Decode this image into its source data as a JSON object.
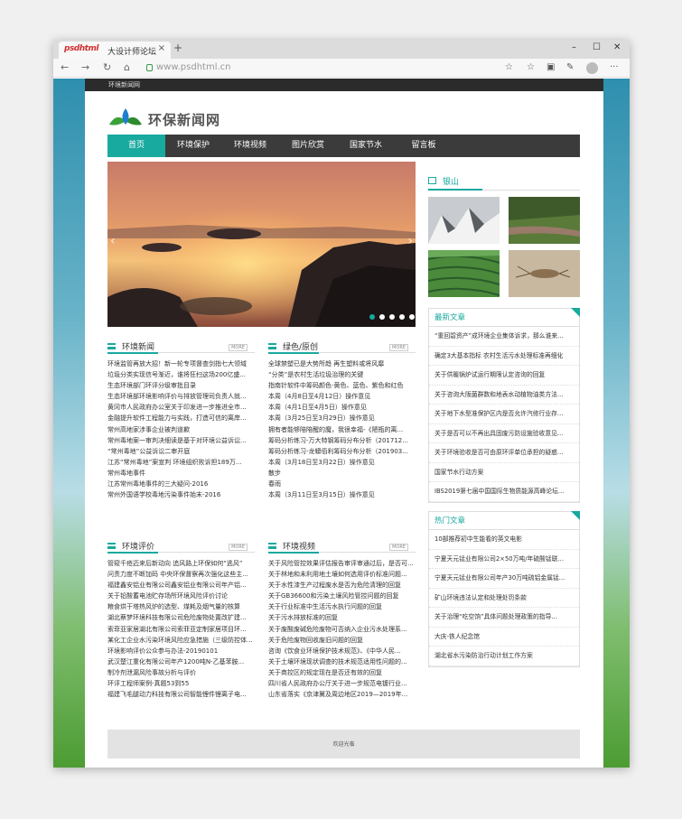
{
  "browser": {
    "tab_logo": "psdhtml",
    "tab_title": "大设计师论坛",
    "tab_close": "×",
    "new_tab": "+",
    "url": "www.psdhtml.cn",
    "win_min": "–",
    "win_max": "☐",
    "win_close": "✕",
    "back": "←",
    "forward": "→",
    "reload": "↻",
    "home": "⌂",
    "star": "☆",
    "more": "···"
  },
  "site": {
    "top_strip": "环境新闻网",
    "logo_text": "环保新闻网",
    "brand_color": "#18a99f",
    "nav": [
      "首页",
      "环境保护",
      "环境视频",
      "图片欣赏",
      "国家节水",
      "留言板"
    ],
    "active_nav": 0
  },
  "sections": {
    "news": {
      "title": "环境新闻",
      "more": "MORE",
      "items": [
        "环境监管再放大招！新一轮专项督查剑指七大领域",
        "垃圾分类实现信号渐近，谁将狂扫这场200亿盛...",
        "生态环境部门环评分级审批目录",
        "生态环境部环境影响评价与排放管理司负责人就...",
        "黄冈市人民政府办公室关于印发进一步推进全市...",
        "金融提升软件工程能力与实践，打造可信的离岸...",
        "常州高地家涉事企业被判道歉",
        "常州毒地案一审判决细读是基于对环境公益诉讼...",
        "“常州毒地”公益诉讼二审开庭",
        "江苏“常州毒地”案宣判 环境组织败诉担189万...",
        "常州毒地事件",
        "江苏常州毒地事件的三大疑问-2016",
        "常州外国语学校毒地污染事件始末-2016"
      ]
    },
    "green": {
      "title": "绿色/原创",
      "more": "MORE",
      "items": [
        "全球禁塑已是大势所趋 再生塑料或将风靡",
        "“分类”是农村生活垃圾治理的关键",
        "指南针软件中筹码颜色-黄色、蓝色、紫色和红色",
        "本周（4月8日至4月12日）操作意见",
        "本周（4月1日至4月5日）操作意见",
        "本周（3月25日至3月29日）操作意见",
        "拥有者能够陪陪醒的魔，我很幸福-《陋瓶的离...",
        "筹码分析练习-万大特钢筹码分布分析（201712...",
        "筹码分析练习-龙蟒佰利筹码分布分析（201903...",
        "本周（3月18日至3月22日）操作意见",
        "散步",
        "春雨",
        "本周（3月11日至3月15日）操作意见"
      ]
    },
    "review": {
      "title": "环境评价",
      "more": "MORE",
      "items": [
        "管窥千疮迈来后新动向 追风路上环保如何“逃风”",
        "问责力度不断加码 中央环保督察再次强化这些主...",
        "福建鑫安铝业有限公司鑫安铝业有限公司年产铝...",
        "关于铅酸蓄电池贮存场所环境风险评价讨论",
        "粮食烘干塔热风炉的选型、煤耗及烟气量的核算",
        "湖北蔡梦环境科技有限公司危险废物处置改扩建...",
        "索菲亚家居湖北有限公司索菲亚定制家居项目环...",
        "某化工企业水污染环境风险应急措施（三级防控体...",
        "环境影响评价公众参与办法-20190101",
        "武汉楚江重化有限公司年产1200吨N-乙基苯胺...",
        "制冷剂泄漏风险事故分析与评价",
        "环评工程师案例-真题53到55",
        "福建飞毛腿动力科技有限公司智能锂件锂离子电..."
      ]
    },
    "video": {
      "title": "环境视频",
      "more": "MORE",
      "items": [
        "关于风险管控效果评估报告审评审通过后，是否可...",
        "关于林地和未利用地土壤如何选用评价标准问题...",
        "关于水性漆生产过程废水是否为危险清理的回复",
        "关于GB36600和污染土壤风险管控问题的回复",
        "关于行业标准中生活污水执行问题的回复",
        "关于污水排放标准的回复",
        "关于废酸废碱危险废物可否纳入企业污水处理系...",
        "关于危险废物回收废旧问题的回复",
        "咨询《饮食业环境保护技术规范》、《中华人民...",
        "关于土壤环境现状调查的技术规范适用性问题的...",
        "关于商控区的规定现在是否还有效的回复",
        "四川省人民政府办公厅关于进一步规范电镀行业...",
        "山东省落实《京津冀及周边地区2019—2019年..."
      ]
    }
  },
  "sidebar": {
    "mountain": {
      "title": "银山"
    },
    "latest": {
      "title": "最新文章",
      "items": [
        "“重回碧资产”成环境企业集体诉求，那么谁来...",
        "确定3大基本指标 农村生活污水处理标准再细化",
        "关于供暖锅炉试运行期限认定咨询的回复",
        "关于咨询大阪菌群数和地表水动植物油类方法...",
        "关于地下水型准保护区内是否允许汽修行业存...",
        "关于是否可以不再出具固废污防设施验收意见...",
        "关于环境验收是否可由原环评单位承担的疑惑...",
        "国家节水行动方案",
        "IBS2019第七届中国国际生物质能源高峰论坛..."
      ]
    },
    "hot": {
      "title": "热门文章",
      "items": [
        "10部推荐初中生能看的英文电影",
        "宁夏天元锰业有限公司2×50万吨/年硫酸锰联...",
        "宁夏天元锰业有限公司年产30万吨硫铝金属锰...",
        "矿山环境违法认定和处理处罚条款",
        "关于治理“吃空饷”具体问题处理政策的指导...",
        "大庆-铁人纪念馆",
        "湖北省水污染防治行动计划工作方案"
      ]
    }
  },
  "footer": {
    "text": "欢迎光临"
  }
}
